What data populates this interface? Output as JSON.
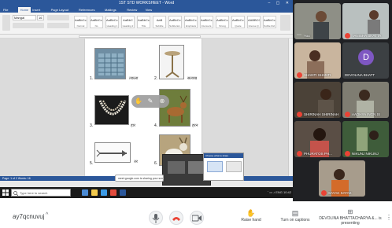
{
  "meeting": {
    "code": "ay7qcnuvuj",
    "presenter_status": "DEVOLINA BHATTACHARYA &... is presenting"
  },
  "toolbar": {
    "raise_hand_label": "Raise hand",
    "captions_label": "Turn on captions",
    "chevron": "^"
  },
  "word": {
    "title_text": "1ST STD WORKSHEET - Word",
    "tabs": [
      "File",
      "Home",
      "Insert",
      "Page Layout",
      "References",
      "Mailings",
      "Review",
      "View"
    ],
    "active_tab": "Home",
    "font_name": "Mangal",
    "font_size": "16",
    "styles": [
      "AaBbCcI",
      "AaBbCcI",
      "AaBbCcI",
      "AaBbC",
      "AaBbCc",
      "AaB",
      "AaBbCcI",
      "AaBbCcI",
      "AaBbCcI",
      "AaBbCcI",
      "AaBbCcI",
      "AABBCCI",
      "AaBbCcI"
    ],
    "style_names": [
      "Normal",
      "No Spacing",
      "Heading 1",
      "Heading 2",
      "Title",
      "Subtitle",
      "Subtle Em.",
      "Emphasis",
      "Intense E.",
      "Strong",
      "Quote",
      "Intense Q.",
      "Subtle Ref."
    ],
    "status_text": "Page: 1 of 2  Words: 16"
  },
  "worksheet": {
    "items": [
      {
        "num": "1.",
        "word": "तकला"
      },
      {
        "num": "2.",
        "word": "सलाख"
      },
      {
        "num": "3.",
        "word": "हार"
      },
      {
        "num": "4.",
        "word": "हरन"
      },
      {
        "num": "5.",
        "word": "तर"
      },
      {
        "num": "6.",
        "word": ""
      }
    ]
  },
  "taskbar": {
    "search_placeholder": "Type here to search"
  },
  "sharing": {
    "pill_text": "meet.google.com is sharing your screen",
    "dialog_title": "Choose what to share"
  },
  "participants": [
    {
      "name": "You",
      "avatar": null,
      "muted": false
    },
    {
      "name": "TANISHA BHATTA",
      "avatar": null,
      "muted": true
    },
    {
      "name": "SHANTI SHANTI",
      "avatar": null,
      "muted": true
    },
    {
      "name": "DEVOLINA BHATT",
      "avatar": "D",
      "muted": false
    },
    {
      "name": "SHIRINAH SHIRINAH",
      "avatar": null,
      "muted": true
    },
    {
      "name": "AADHYA INGN SI",
      "avatar": null,
      "muted": true
    },
    {
      "name": "PHURATOS PH...",
      "avatar": null,
      "muted": true
    },
    {
      "name": "NIKUNJ NIKUNJ",
      "avatar": null,
      "muted": true
    },
    {
      "name": "SAYAK SATAK",
      "avatar": null,
      "muted": true
    }
  ],
  "colors": {
    "word_blue": "#2b579a",
    "end_call_red": "#ea4335",
    "avatar_purple": "#7e57c2"
  },
  "icons": {
    "mic": "microphone-icon",
    "end_call": "phone-hangup-icon",
    "camera": "camera-icon",
    "raise_hand": "raise-hand-icon",
    "captions": "captions-icon",
    "present": "present-icon",
    "more": "more-options-icon"
  }
}
